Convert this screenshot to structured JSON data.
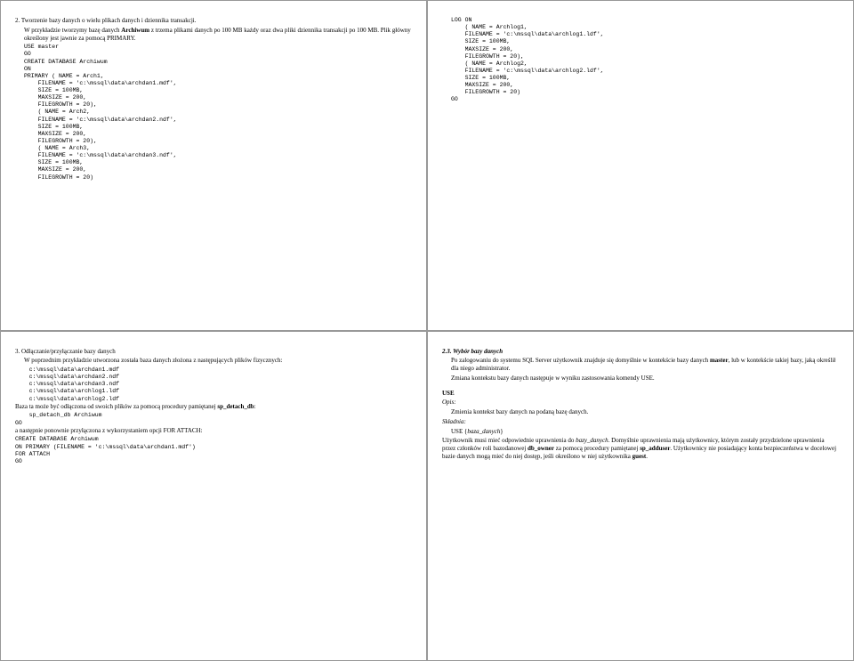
{
  "tl": {
    "p1": "2. Tworzenie bazy danych o wielu plikach danych i dziennika transakcji.",
    "p2a": "W przykładzie tworzymy bazę danych ",
    "p2b": "Archiwum",
    "p2c": " z trzema plikami danych po 100 MB każdy oraz dwa pliki dziennika transakcji po 100 MB. Plik główny określony jest jawnie za pomocą PRIMARY.",
    "code": "USE master\nGO\nCREATE DATABASE Archiwum\nON\nPRIMARY ( NAME = Arch1,\n    FILENAME = 'c:\\mssql\\data\\archdan1.mdf',\n    SIZE = 100MB,\n    MAXSIZE = 200,\n    FILEGROWTH = 20),\n    ( NAME = Arch2,\n    FILENAME = 'c:\\mssql\\data\\archdan2.ndf',\n    SIZE = 100MB,\n    MAXSIZE = 200,\n    FILEGROWTH = 20),\n    ( NAME = Arch3,\n    FILENAME = 'c:\\mssql\\data\\archdan3.ndf',\n    SIZE = 100MB,\n    MAXSIZE = 200,\n    FILEGROWTH = 20)"
  },
  "tr": {
    "code": "LOG ON\n    ( NAME = Archlog1,\n    FILENAME = 'c:\\mssql\\data\\archlog1.ldf',\n    SIZE = 100MB,\n    MAXSIZE = 200,\n    FILEGROWTH = 20),\n    ( NAME = Archlog2,\n    FILENAME = 'c:\\mssql\\data\\archlog2.ldf',\n    SIZE = 100MB,\n    MAXSIZE = 200,\n    FILEGROWTH = 20)\nGO"
  },
  "bl": {
    "p1": "3. Odłączanie/przyłączanie bazy danych",
    "p2": "W poprzednim przykładzie utworzona została baza danych złożona z następujących plików fizycznych:",
    "files": "    c:\\mssql\\data\\archdan1.mdf\n    c:\\mssql\\data\\archdan2.ndf\n    c:\\mssql\\data\\archdan3.ndf\n    c:\\mssql\\data\\archlog1.ldf\n    c:\\mssql\\data\\archlog2.ldf",
    "p3a": "Baza ta może być odłączona od swoich plików za pomocą procedury pamiętanej ",
    "p3b": "sp_detach_db",
    "p3c": ":",
    "code1": "    sp_detach_db Archiwum\nGO",
    "p4": "a następnie ponownie przyłączona z wykorzystaniem opcji FOR ATTACH:",
    "code2": "CREATE DATABASE Archiwum\nON PRIMARY (FILENAME = 'c:\\mssql\\data\\archdan1.mdf')\nFOR ATTACH\nGO"
  },
  "br": {
    "h1a": "2.3. ",
    "h1b": "Wybór bazy danych",
    "p1a": "Po zalogowaniu do systemu SQL Server użytkownik znajduje się domyślnie w kontekście bazy danych ",
    "p1b": "master",
    "p1c": ", lub w kontekście takiej bazy, jaką określił dla niego administrator.",
    "p2": "Zmiana kontekstu bazy danych następuje w wyniku zastosowania komendy USE.",
    "use": "USE",
    "opis": "Opis:",
    "opis_t": "Zmienia kontekst bazy danych na podaną bazę danych.",
    "skl": "Składnia:",
    "skl_t1": "USE {",
    "skl_t2": "baza_danych",
    "skl_t3": "}",
    "p3a": "Użytkownik musi mieć odpowiednie uprawnienia do ",
    "p3b": "bazy_danych",
    "p3c": ". Domyślnie uprawnienia mają użytkownicy, którym zostały przydzielone uprawnienia przez członków roli bazodanowej ",
    "p3d": "db_owner",
    "p3e": " za pomocą procedury pamiętanej ",
    "p3f": "sp_adduser",
    "p3g": ". Użytkownicy nie posiadający konta bezpieczeństwa w docelowej bazie danych mogą mieć do niej dostęp, jeśli określono w niej użytkownika ",
    "p3h": "guest",
    "p3i": "."
  }
}
